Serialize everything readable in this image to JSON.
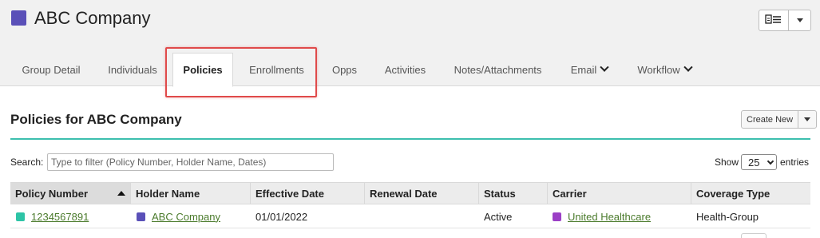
{
  "header": {
    "company_name": "ABC Company",
    "company_color": "#5a50b8",
    "actions": {
      "primary_icon": "document-list-icon",
      "dropdown_icon": "caret-down-icon"
    }
  },
  "tabs": [
    {
      "label": "Group Detail",
      "active": false
    },
    {
      "label": "Individuals",
      "active": false
    },
    {
      "label": "Policies",
      "active": true
    },
    {
      "label": "Enrollments",
      "active": false
    },
    {
      "label": "Opps",
      "active": false
    },
    {
      "label": "Activities",
      "active": false
    },
    {
      "label": "Notes/Attachments",
      "active": false
    },
    {
      "label": "Email",
      "active": false,
      "has_dropdown": true
    },
    {
      "label": "Workflow",
      "active": false,
      "has_dropdown": true
    }
  ],
  "section": {
    "title": "Policies for ABC Company",
    "create_label": "Create New",
    "accent_color": "#3cbfae"
  },
  "search": {
    "label": "Search:",
    "placeholder": "Type to filter (Policy Number, Holder Name, Dates)",
    "value": ""
  },
  "length": {
    "show_label": "Show",
    "selected": "25",
    "entries_label": "entries"
  },
  "table": {
    "columns": [
      "Policy Number",
      "Holder Name",
      "Effective Date",
      "Renewal Date",
      "Status",
      "Carrier",
      "Coverage Type"
    ],
    "sorted_column": "Policy Number",
    "sort_direction": "asc",
    "rows": [
      {
        "policy_number": "1234567891",
        "policy_color": "#2ec4a6",
        "holder_name": "ABC Company",
        "holder_color": "#5a50b8",
        "effective_date": "01/01/2022",
        "renewal_date": "",
        "status": "Active",
        "carrier": "United Healthcare",
        "carrier_color": "#9b3fc6",
        "coverage_type": "Health-Group"
      }
    ]
  }
}
